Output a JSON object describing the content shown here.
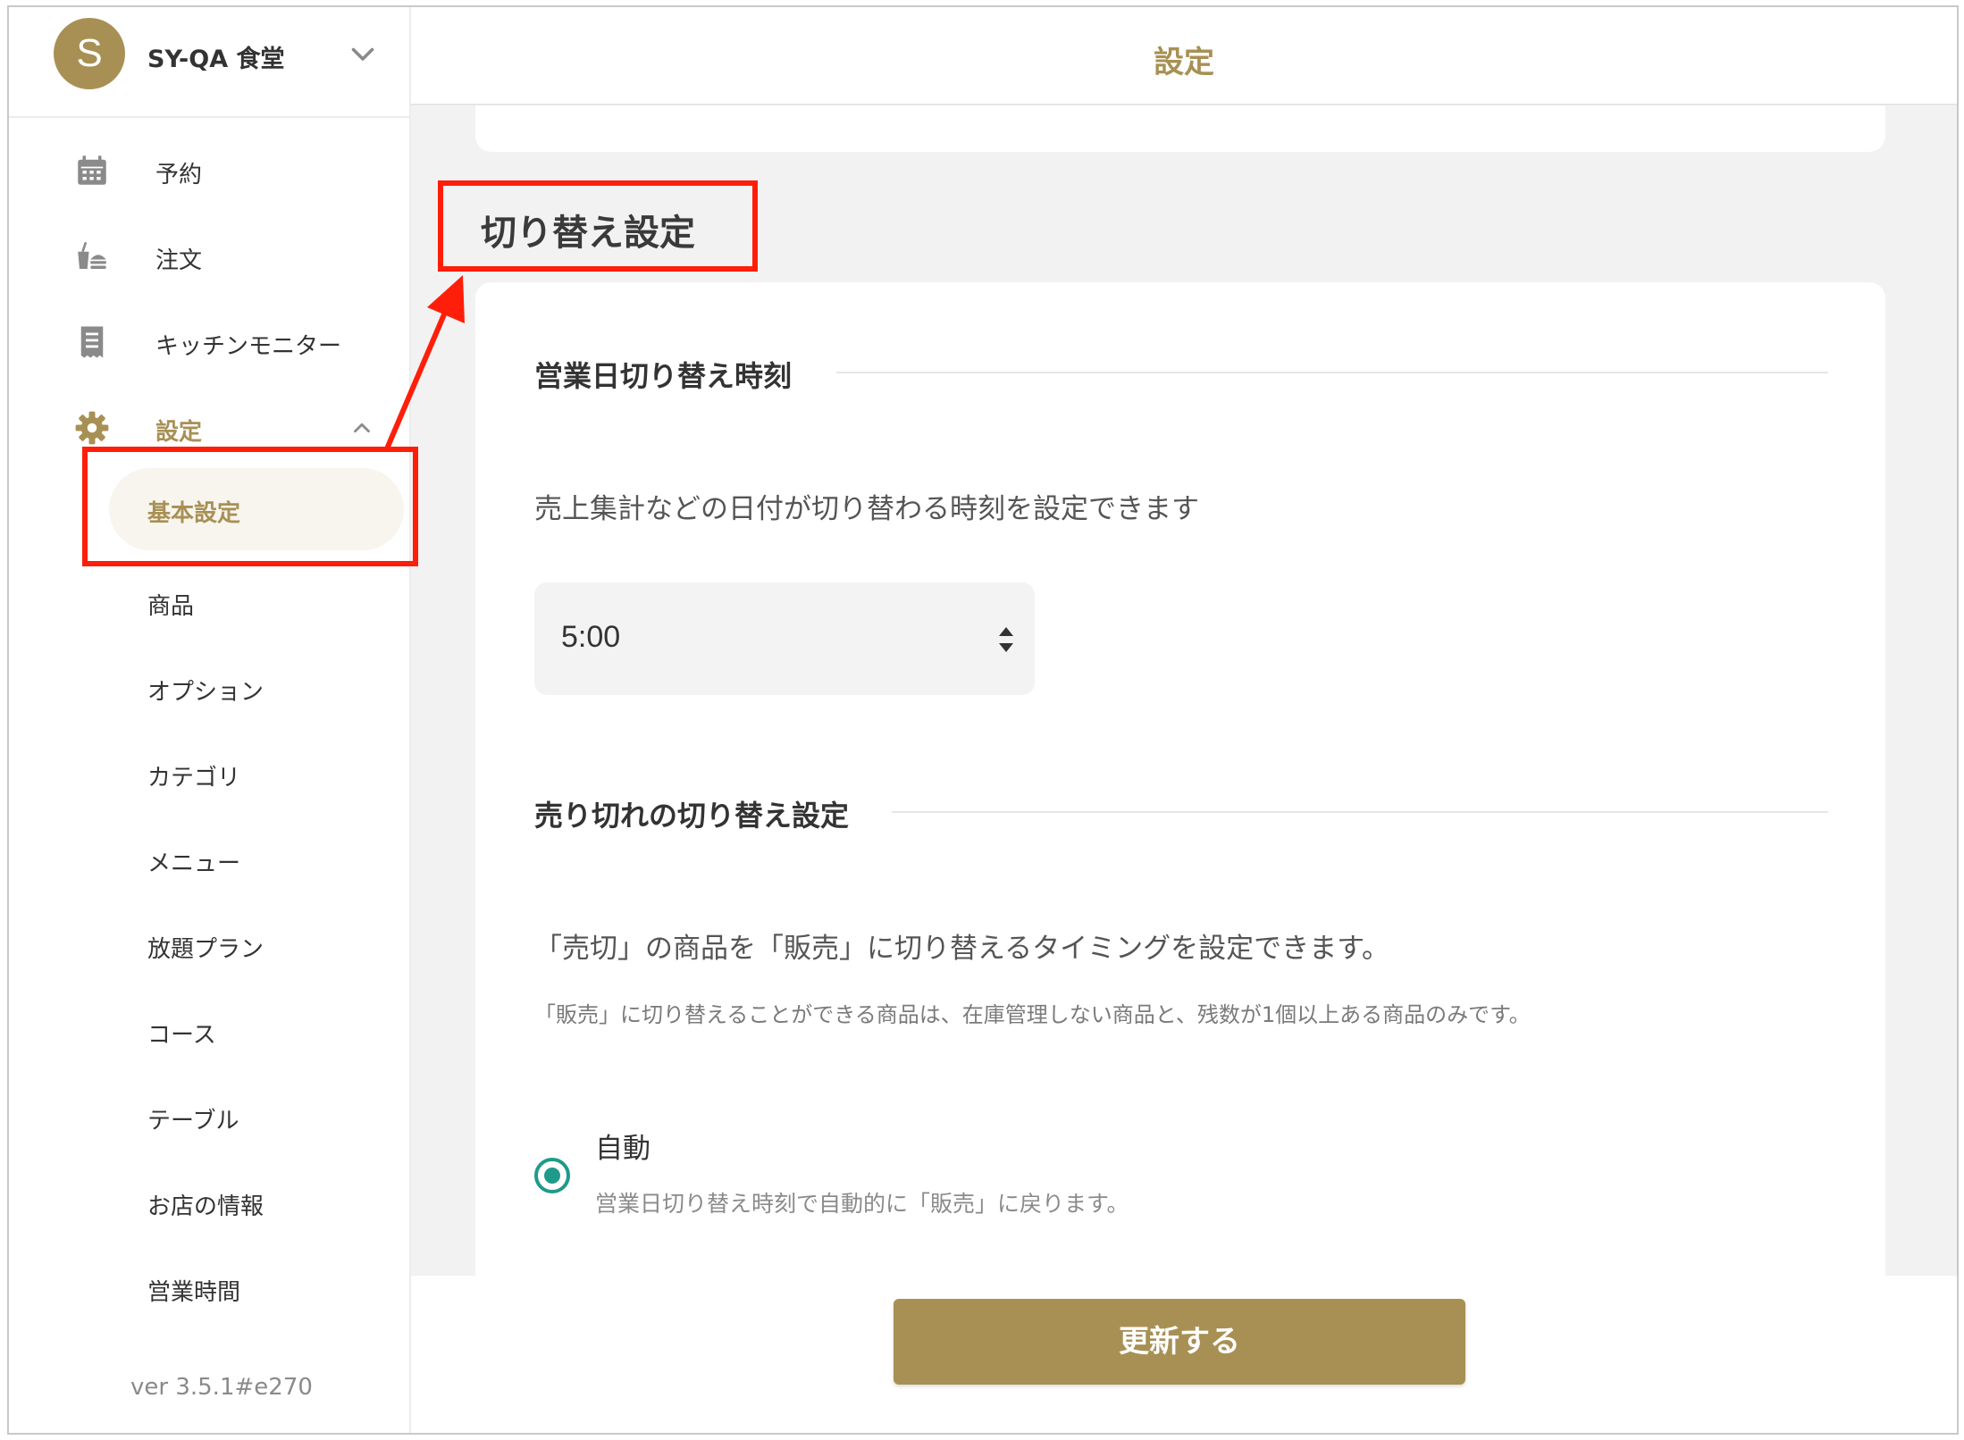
{
  "store": {
    "avatar_letter": "S",
    "name": "SY-QA 食堂"
  },
  "nav": {
    "reservation": "予約",
    "order": "注文",
    "kitchen_monitor": "キッチンモニター",
    "settings": "設定"
  },
  "settings_sub": [
    "基本設定",
    "商品",
    "オプション",
    "カテゴリ",
    "メニュー",
    "放題プラン",
    "コース",
    "テーブル",
    "お店の情報",
    "営業時間"
  ],
  "version": "ver 3.5.1#e270",
  "header": {
    "title": "設定"
  },
  "section": {
    "title": "切り替え設定",
    "business_day": {
      "heading": "営業日切り替え時刻",
      "description": "売上集計などの日付が切り替わる時刻を設定できます",
      "time_value": "5:00"
    },
    "soldout": {
      "heading": "売り切れの切り替え設定",
      "description": "「売切」の商品を「販売」に切り替えるタイミングを設定できます。",
      "note": "「販売」に切り替えることができる商品は、在庫管理しない商品と、残数が1個以上ある商品のみです。",
      "option_label": "自動",
      "option_description": "営業日切り替え時刻で自動的に「販売」に戻ります。",
      "option_selected": true
    }
  },
  "actions": {
    "update_label": "更新する"
  },
  "colors": {
    "accent": "#a89055",
    "radio": "#1f9a8a",
    "annotation": "#ff1e0a"
  }
}
